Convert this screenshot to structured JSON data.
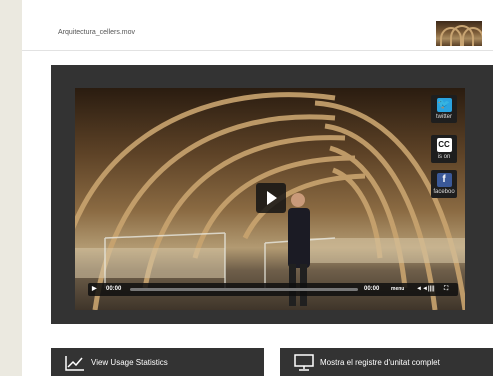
{
  "file": {
    "name": "Arquitectura_cellers.mov",
    "thumbnail_icon": "video-thumbnail-image"
  },
  "player": {
    "social": {
      "twitter_label": "twitter",
      "cc_glyph": "CC",
      "cc_label": "is on",
      "facebook_glyph": "f",
      "facebook_label": "faceboo"
    },
    "controls": {
      "play_glyph": "▶",
      "current_time": "00:00",
      "duration": "00:00",
      "progress": 0,
      "menu_label": "menu",
      "volume_glyph": "◄◄||||",
      "fullscreen_glyph": "⛶"
    },
    "colors": {
      "twitter": "#2aa3e0",
      "facebook": "#3b5998",
      "cc": "#ffffff"
    }
  },
  "actions": {
    "usage_stats_label": "View Usage Statistics",
    "full_record_label": "Mostra el registre d'unitat complet"
  }
}
